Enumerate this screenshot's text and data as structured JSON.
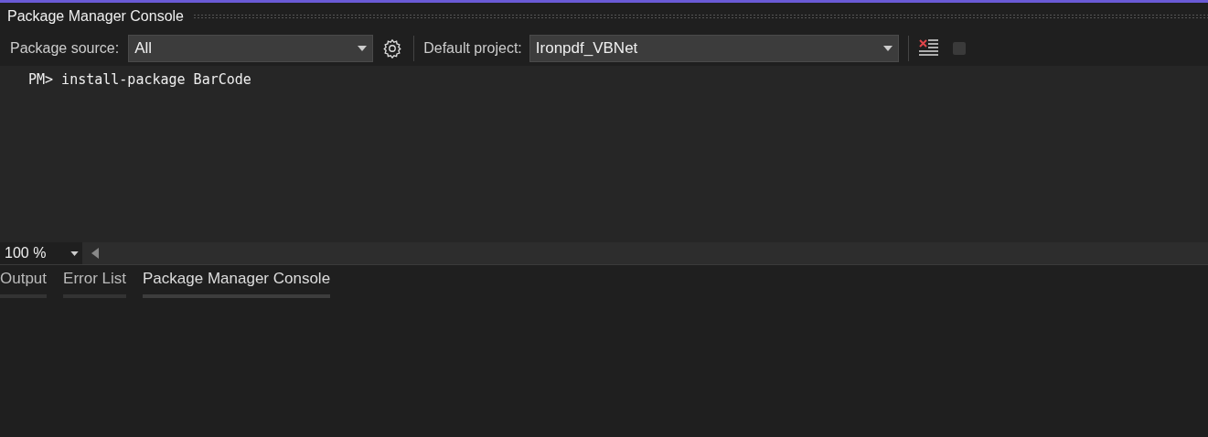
{
  "window": {
    "title": "Package Manager Console"
  },
  "toolbar": {
    "source_label": "Package source:",
    "source_value": "All",
    "project_label": "Default project:",
    "project_value": "Ironpdf_VBNet"
  },
  "console": {
    "prompt": "PM>",
    "command": "install-package BarCode"
  },
  "zoom": {
    "value": "100 %"
  },
  "tabs": [
    {
      "label": "Output",
      "selected": false
    },
    {
      "label": "Error List",
      "selected": false
    },
    {
      "label": "Package Manager Console",
      "selected": true
    }
  ]
}
